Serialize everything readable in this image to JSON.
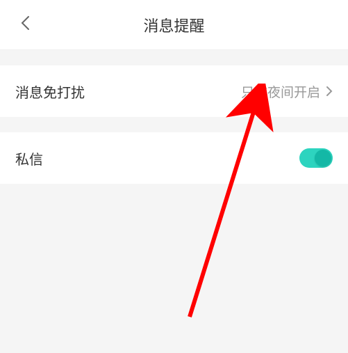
{
  "header": {
    "title": "消息提醒"
  },
  "settings": {
    "dnd": {
      "label": "消息免打扰",
      "value": "只在夜间开启"
    },
    "dm": {
      "label": "私信",
      "enabled": true
    }
  },
  "annotation": {
    "arrow_color": "#ff0000"
  }
}
